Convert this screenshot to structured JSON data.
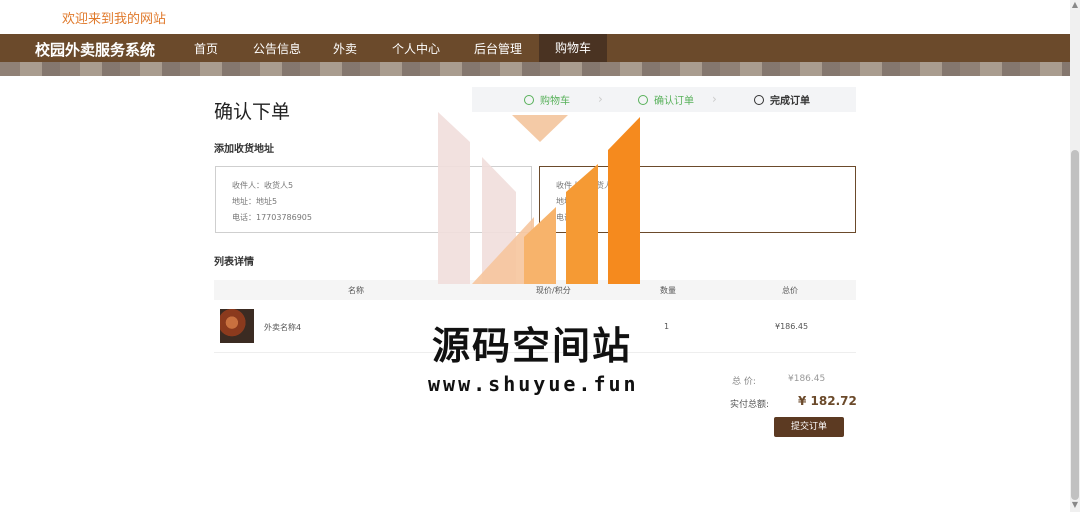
{
  "header": {
    "welcome": "欢迎来到我的网站"
  },
  "nav": {
    "brand": "校园外卖服务系统",
    "items": [
      {
        "label": "首页"
      },
      {
        "label": "公告信息"
      },
      {
        "label": "外卖"
      },
      {
        "label": "个人中心"
      },
      {
        "label": "后台管理"
      },
      {
        "label": "购物车",
        "active": true
      }
    ]
  },
  "page": {
    "title": "确认下单"
  },
  "steps": [
    {
      "label": "购物车",
      "status": "done"
    },
    {
      "label": "确认订单",
      "status": "done"
    },
    {
      "label": "完成订单",
      "status": "todo"
    }
  ],
  "address": {
    "section_title": "添加收货地址",
    "cards": [
      {
        "recipient": "收件人：收货人5",
        "address": "地址：地址5",
        "phone": "电话：17703786905",
        "selected": false
      },
      {
        "recipient": "收件人：收货人",
        "address": "地址：",
        "phone": "电话：378",
        "selected": true
      }
    ]
  },
  "list": {
    "section_title": "列表详情",
    "headers": [
      "名称",
      "现价/积分",
      "数量",
      "总价"
    ],
    "rows": [
      {
        "name": "外卖名称4",
        "price": "",
        "quantity": "1",
        "total": "¥186.45"
      }
    ]
  },
  "summary": {
    "total_label": "总  价:",
    "total_value": "¥186.45",
    "real_label": "实付总额:",
    "real_value": "¥ 182.72",
    "submit_label": "提交订单"
  },
  "watermark": {
    "text": "源码空间站",
    "url": "www.shuyue.fun"
  },
  "colors": {
    "nav_bg": "#6b4a2b",
    "accent_orange": "#e07a2c",
    "step_done": "#58b15a"
  }
}
